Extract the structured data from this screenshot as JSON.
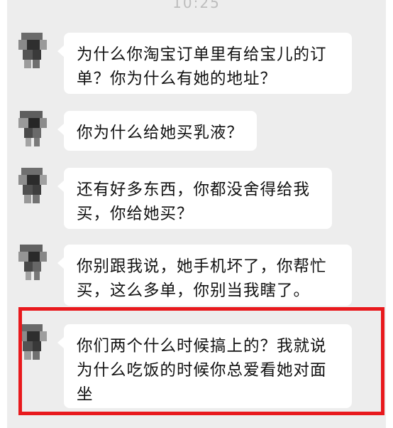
{
  "status": {
    "time": "10:25"
  },
  "messages": [
    {
      "text": "为什么你淘宝订单里有给宝儿的订单？你为什么有她的地址？"
    },
    {
      "text": "你为什么给她买乳液？"
    },
    {
      "text": "还有好多东西，你都没舍得给我买，你给她买？"
    },
    {
      "text": "你别跟我说，她手机坏了，你帮忙买，这么多单，你别当我瞎了。"
    },
    {
      "text": "你们两个什么时候搞上的？我就说为什么吃饭的时候你总爱看她对面坐"
    }
  ],
  "colors": {
    "highlight": "#e8191d",
    "chat_background": "#ededed",
    "bubble": "#ffffff"
  }
}
